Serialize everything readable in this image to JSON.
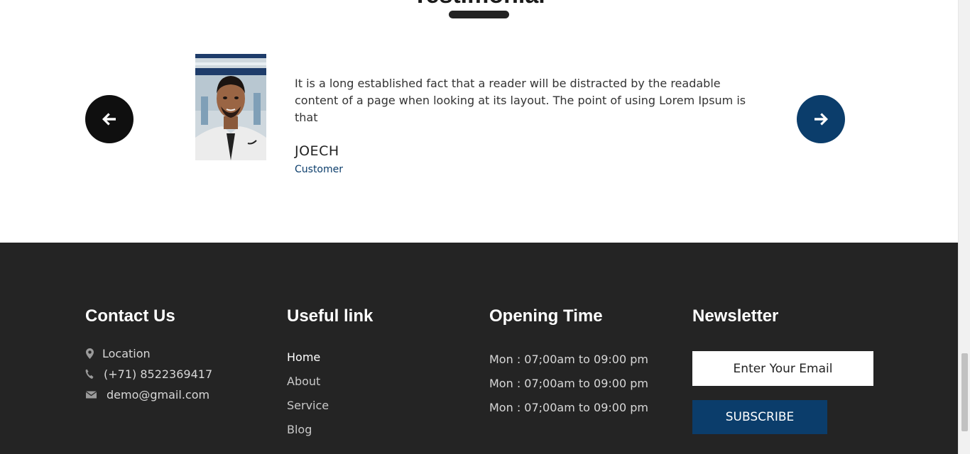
{
  "testimonial": {
    "section_title": "Testimonial",
    "quote": "It is a long established fact that a reader will be distracted by the readable content of a page when looking at its layout. The point of using Lorem Ipsum is that",
    "name": "JOECH",
    "role": "Customer",
    "prev_icon": "arrow-left-icon",
    "next_icon": "arrow-right-icon"
  },
  "footer": {
    "contact": {
      "title": "Contact Us",
      "items": [
        {
          "icon": "location-pin-icon",
          "text": "Location"
        },
        {
          "icon": "phone-icon",
          "text": "(+71) 8522369417"
        },
        {
          "icon": "envelope-icon",
          "text": "demo@gmail.com"
        }
      ]
    },
    "links": {
      "title": "Useful link",
      "items": [
        "Home",
        "About",
        "Service",
        "Blog"
      ]
    },
    "opening": {
      "title": "Opening Time",
      "items": [
        "Mon : 07;00am to 09:00 pm",
        "Mon : 07;00am to 09:00 pm",
        "Mon : 07;00am to 09:00 pm"
      ]
    },
    "newsletter": {
      "title": "Newsletter",
      "placeholder": "Enter Your Email",
      "button": "SUBSCRIBE"
    }
  },
  "colors": {
    "accent": "#0b3d6b",
    "footer_bg": "#242424",
    "dark_button": "#0f0f0f"
  }
}
